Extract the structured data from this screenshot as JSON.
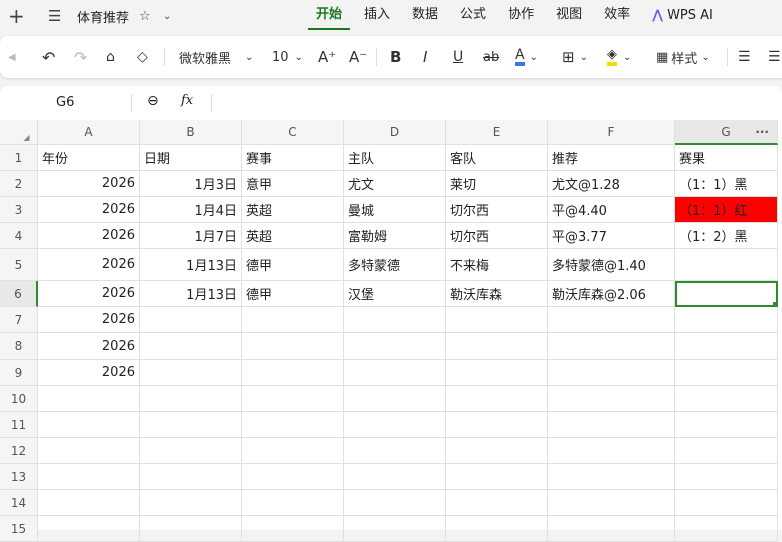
{
  "title": "体育推荐",
  "tabs": [
    "开始",
    "插入",
    "数据",
    "公式",
    "协作",
    "视图",
    "效率",
    "WPS AI"
  ],
  "toolbar": {
    "font": "微软雅黑",
    "size": "10",
    "style_label": "样式"
  },
  "formula_bar": {
    "cell_ref": "G6",
    "fx": "fx",
    "value": ""
  },
  "columns": [
    "A",
    "B",
    "C",
    "D",
    "E",
    "F",
    "G"
  ],
  "rows": [
    [
      "年份",
      "日期",
      "赛事",
      "主队",
      "客队",
      "推荐",
      "赛果"
    ],
    [
      "2026",
      "1月3日",
      "意甲",
      "尤文",
      "莱切",
      "尤文@1.28",
      "（1：1）黑"
    ],
    [
      "2026",
      "1月4日",
      "英超",
      "曼城",
      "切尔西",
      "平@4.40",
      "（1：1）红"
    ],
    [
      "2026",
      "1月7日",
      "英超",
      "富勒姆",
      "切尔西",
      "平@3.77",
      "（1：2）黑"
    ],
    [
      "2026",
      "1月13日",
      "德甲",
      "多特蒙德",
      "不来梅",
      "多特蒙德@1.40",
      ""
    ],
    [
      "2026",
      "1月13日",
      "德甲",
      "汉堡",
      "勒沃库森",
      "勒沃库森@2.06",
      ""
    ],
    [
      "2026",
      "",
      "",
      "",
      "",
      "",
      ""
    ],
    [
      "2026",
      "",
      "",
      "",
      "",
      "",
      ""
    ],
    [
      "2026",
      "",
      "",
      "",
      "",
      "",
      ""
    ],
    [
      "",
      "",
      "",
      "",
      "",
      "",
      ""
    ],
    [
      "",
      "",
      "",
      "",
      "",
      "",
      ""
    ],
    [
      "",
      "",
      "",
      "",
      "",
      "",
      ""
    ],
    [
      "",
      "",
      "",
      "",
      "",
      "",
      ""
    ],
    [
      "",
      "",
      "",
      "",
      "",
      "",
      ""
    ],
    [
      "",
      "",
      "",
      "",
      "",
      "",
      ""
    ]
  ],
  "row_numbers": [
    "1",
    "2",
    "3",
    "4",
    "5",
    "6",
    "7",
    "8",
    "9",
    "10",
    "11",
    "12",
    "13",
    "14",
    "15"
  ],
  "colors": {
    "accent": "#1b7a1b",
    "red_fill": "#ff0000",
    "selection": "#2e8b2e"
  },
  "selected_cell": "G6"
}
